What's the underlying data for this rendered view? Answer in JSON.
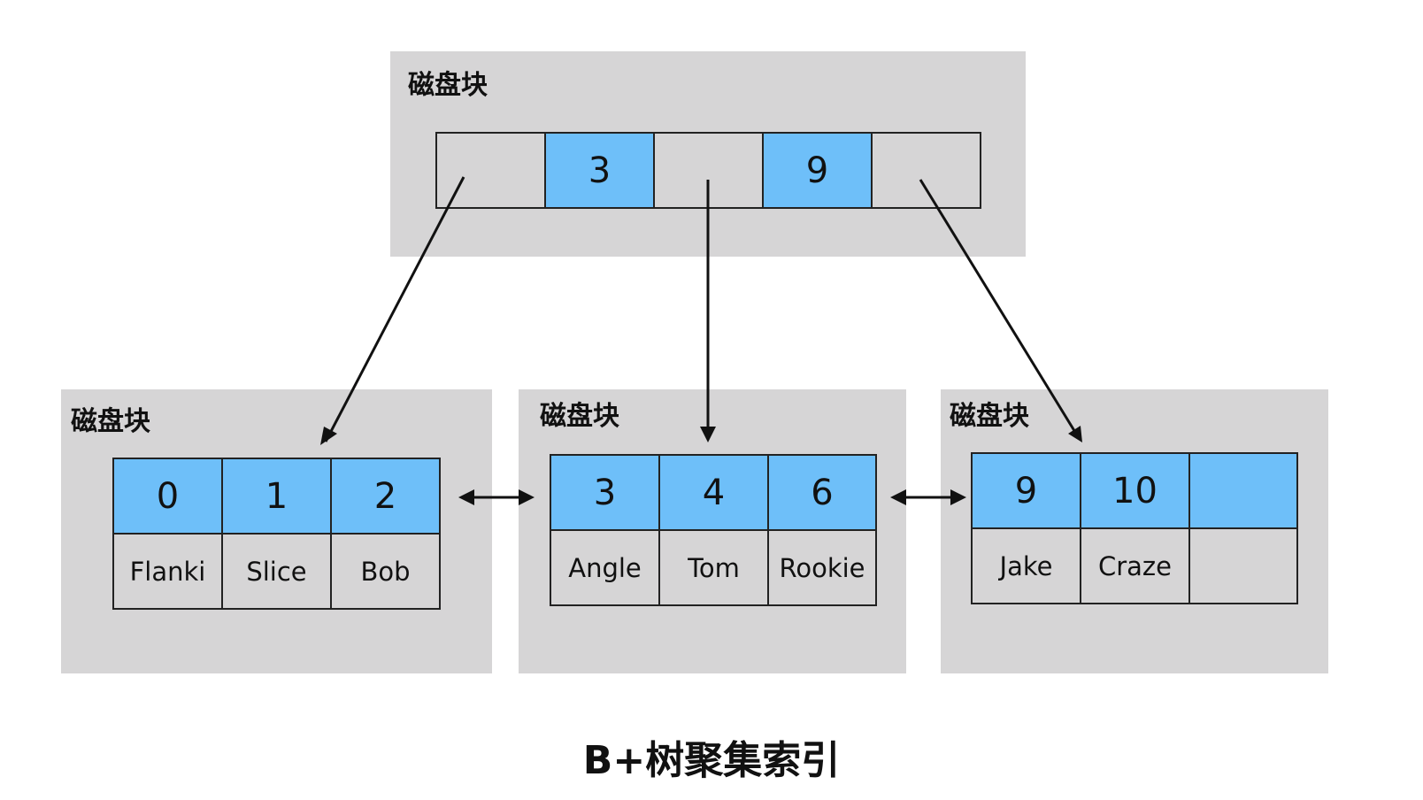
{
  "root": {
    "label": "磁盘块",
    "cells": [
      {
        "kind": "ptr",
        "text": ""
      },
      {
        "kind": "key",
        "text": "3"
      },
      {
        "kind": "ptr",
        "text": ""
      },
      {
        "kind": "key",
        "text": "9"
      },
      {
        "kind": "ptr",
        "text": ""
      }
    ]
  },
  "leaves": [
    {
      "label": "磁盘块",
      "keys": [
        "0",
        "1",
        "2"
      ],
      "values": [
        "Flanki",
        "Slice",
        "Bob"
      ]
    },
    {
      "label": "磁盘块",
      "keys": [
        "3",
        "4",
        "6"
      ],
      "values": [
        "Angle",
        "Tom",
        "Rookie"
      ]
    },
    {
      "label": "磁盘块",
      "keys": [
        "9",
        "10",
        ""
      ],
      "values": [
        "Jake",
        "Craze",
        ""
      ]
    }
  ],
  "caption": "B+树聚集索引",
  "colors": {
    "block_bg": "#d6d5d6",
    "key_bg": "#6ebff9",
    "border": "#222222",
    "arrow": "#111111"
  }
}
